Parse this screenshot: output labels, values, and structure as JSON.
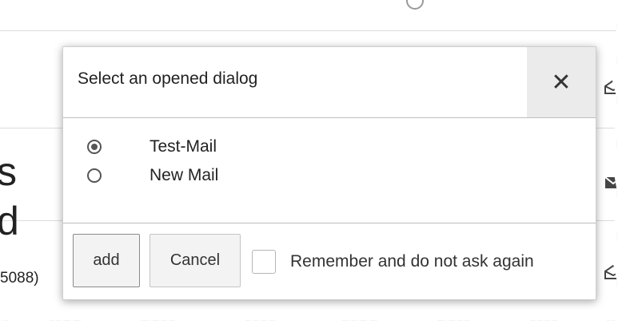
{
  "dialog": {
    "title": "Select an opened dialog",
    "close_glyph": "✕",
    "options": [
      {
        "label": "Test-Mail",
        "selected": true
      },
      {
        "label": "New Mail",
        "selected": false
      }
    ],
    "add_label": "add",
    "cancel_label": "Cancel",
    "remember_label": "Remember and do not ask again",
    "remember_checked": false
  },
  "background": {
    "big_letter": "s",
    "big_letter_2": "d",
    "partial_text": "5088)",
    "icons": [
      "envelope-open-icon",
      "envelope-icon",
      "envelope-open-icon"
    ]
  },
  "colors": {
    "close_bg": "#ebebeb",
    "border": "#bdbdbd",
    "text": "#222222"
  }
}
